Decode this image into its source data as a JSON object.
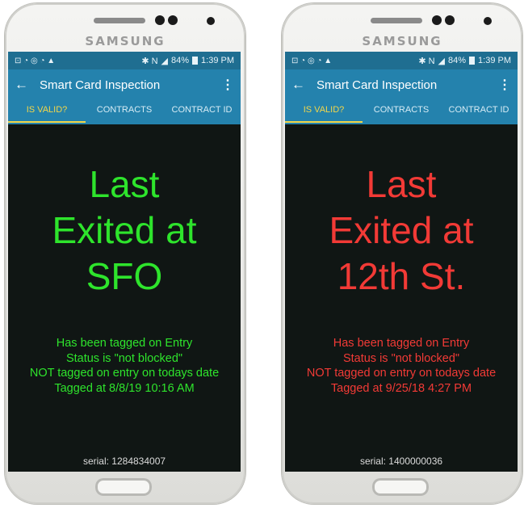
{
  "phones": [
    {
      "brand": "SAMSUNG",
      "status": {
        "icons": "⊡ ◔ ◎ ◔ ▲",
        "right_icons": "✱ N",
        "battery": "84%",
        "time": "1:39 PM"
      },
      "app_title": "Smart Card Inspection",
      "tabs": [
        "IS VALID?",
        "CONTRACTS",
        "CONTRACT ID"
      ],
      "result_lines": [
        "Last",
        "Exited at",
        "SFO"
      ],
      "details": [
        "Has been tagged on Entry",
        "Status is \"not blocked\"",
        "NOT tagged on entry on todays date",
        "Tagged at 8/8/19 10:16 AM"
      ],
      "serial": "serial: 1284834007",
      "accent": "#2ee42c"
    },
    {
      "brand": "SAMSUNG",
      "status": {
        "icons": "⊡ ◔ ◎ ◔ ▲",
        "right_icons": "✱ N",
        "battery": "84%",
        "time": "1:39 PM"
      },
      "app_title": "Smart Card Inspection",
      "tabs": [
        "IS VALID?",
        "CONTRACTS",
        "CONTRACT ID"
      ],
      "result_lines": [
        "Last",
        "Exited at",
        "12th St."
      ],
      "details": [
        "Has been tagged on Entry",
        "Status is \"not blocked\"",
        "NOT tagged on entry on todays date",
        "Tagged at 9/25/18 4:27 PM"
      ],
      "serial": "serial: 1400000036",
      "accent": "#f23a36"
    }
  ],
  "colors": {
    "appbar": "#2482ad",
    "statusbar": "#1f6e91",
    "active_tab": "#f2d64a",
    "screen_bg": "#101614"
  }
}
